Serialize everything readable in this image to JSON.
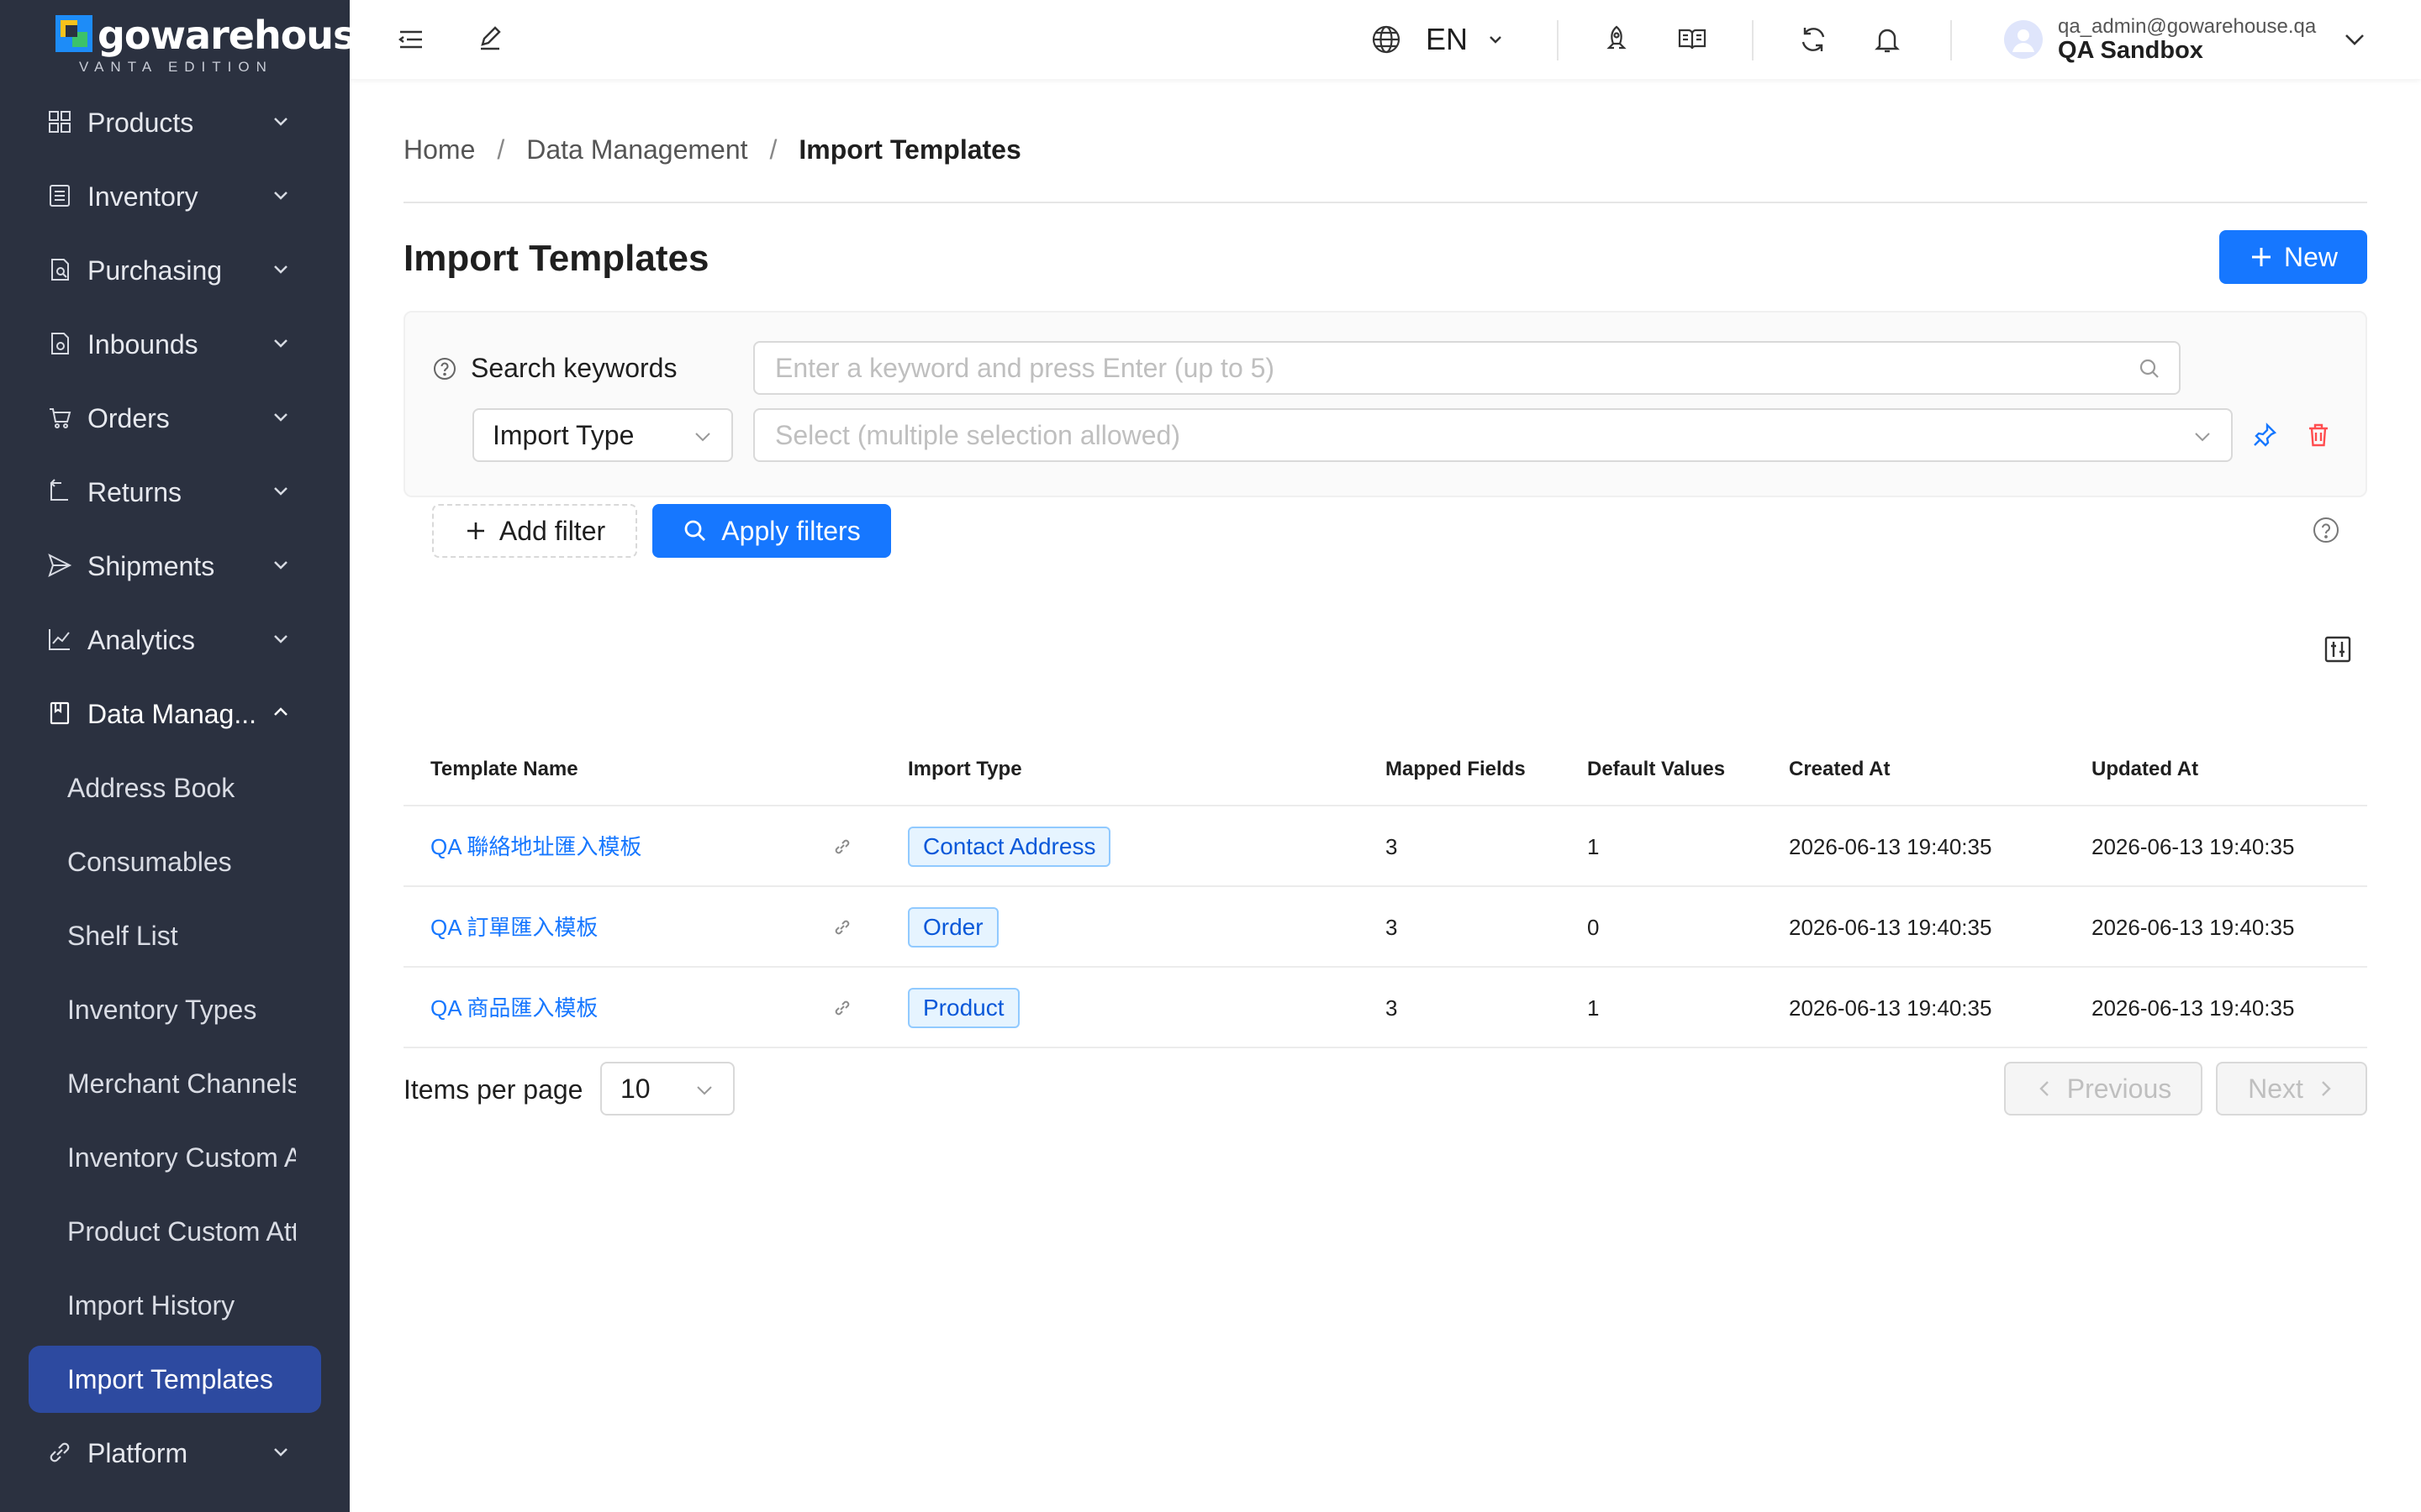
{
  "brand": {
    "name": "gowarehouse",
    "edition": "VANTA EDITION"
  },
  "sidebar": {
    "items": [
      {
        "label": "Products",
        "icon": "grid-icon"
      },
      {
        "label": "Inventory",
        "icon": "list-icon"
      },
      {
        "label": "Purchasing",
        "icon": "doc-search-icon"
      },
      {
        "label": "Inbounds",
        "icon": "doc-gear-icon"
      },
      {
        "label": "Orders",
        "icon": "cart-icon"
      },
      {
        "label": "Returns",
        "icon": "return-icon"
      },
      {
        "label": "Shipments",
        "icon": "send-icon"
      },
      {
        "label": "Analytics",
        "icon": "line-chart-icon"
      }
    ],
    "open_group": {
      "label": "Data Manag...",
      "icon": "book-icon"
    },
    "sub_items": [
      "Address Book",
      "Consumables",
      "Shelf List",
      "Inventory Types",
      "Merchant Channels",
      "Inventory Custom Attributes",
      "Product Custom Attributes",
      "Import History",
      "Import Templates"
    ],
    "active_sub": "Import Templates",
    "bottom_item": {
      "label": "Platform",
      "icon": "link-icon"
    }
  },
  "topbar": {
    "language": "EN",
    "user_email": "qa_admin@gowarehouse.qa",
    "org_name": "QA Sandbox"
  },
  "breadcrumb": [
    "Home",
    "Data Management",
    "Import Templates"
  ],
  "page": {
    "title": "Import Templates",
    "new_button": "New"
  },
  "filters": {
    "keyword_label": "Search keywords",
    "keyword_placeholder": "Enter a keyword and press Enter (up to 5)",
    "type_field": "Import Type",
    "type_placeholder": "Select (multiple selection allowed)",
    "add_filter": "Add filter",
    "apply": "Apply filters"
  },
  "table": {
    "columns": [
      "Template Name",
      "Import Type",
      "Mapped Fields",
      "Default Values",
      "Created At",
      "Updated At"
    ],
    "rows": [
      {
        "name": "QA 聯絡地址匯入模板",
        "type": "Contact Address",
        "mapped": "3",
        "defaults": "1",
        "created": "2026-06-13 19:40:35",
        "updated": "2026-06-13 19:40:35"
      },
      {
        "name": "QA 訂單匯入模板",
        "type": "Order",
        "mapped": "3",
        "defaults": "0",
        "created": "2026-06-13 19:40:35",
        "updated": "2026-06-13 19:40:35"
      },
      {
        "name": "QA 商品匯入模板",
        "type": "Product",
        "mapped": "3",
        "defaults": "1",
        "created": "2026-06-13 19:40:35",
        "updated": "2026-06-13 19:40:35"
      }
    ]
  },
  "pagination": {
    "label": "Items per page",
    "page_size": "10",
    "previous": "Previous",
    "next": "Next"
  },
  "colors": {
    "primary": "#1677ff",
    "sidebar_bg": "#2b3140",
    "active_bg": "#2d4aa0",
    "danger": "#ff4d4f"
  }
}
